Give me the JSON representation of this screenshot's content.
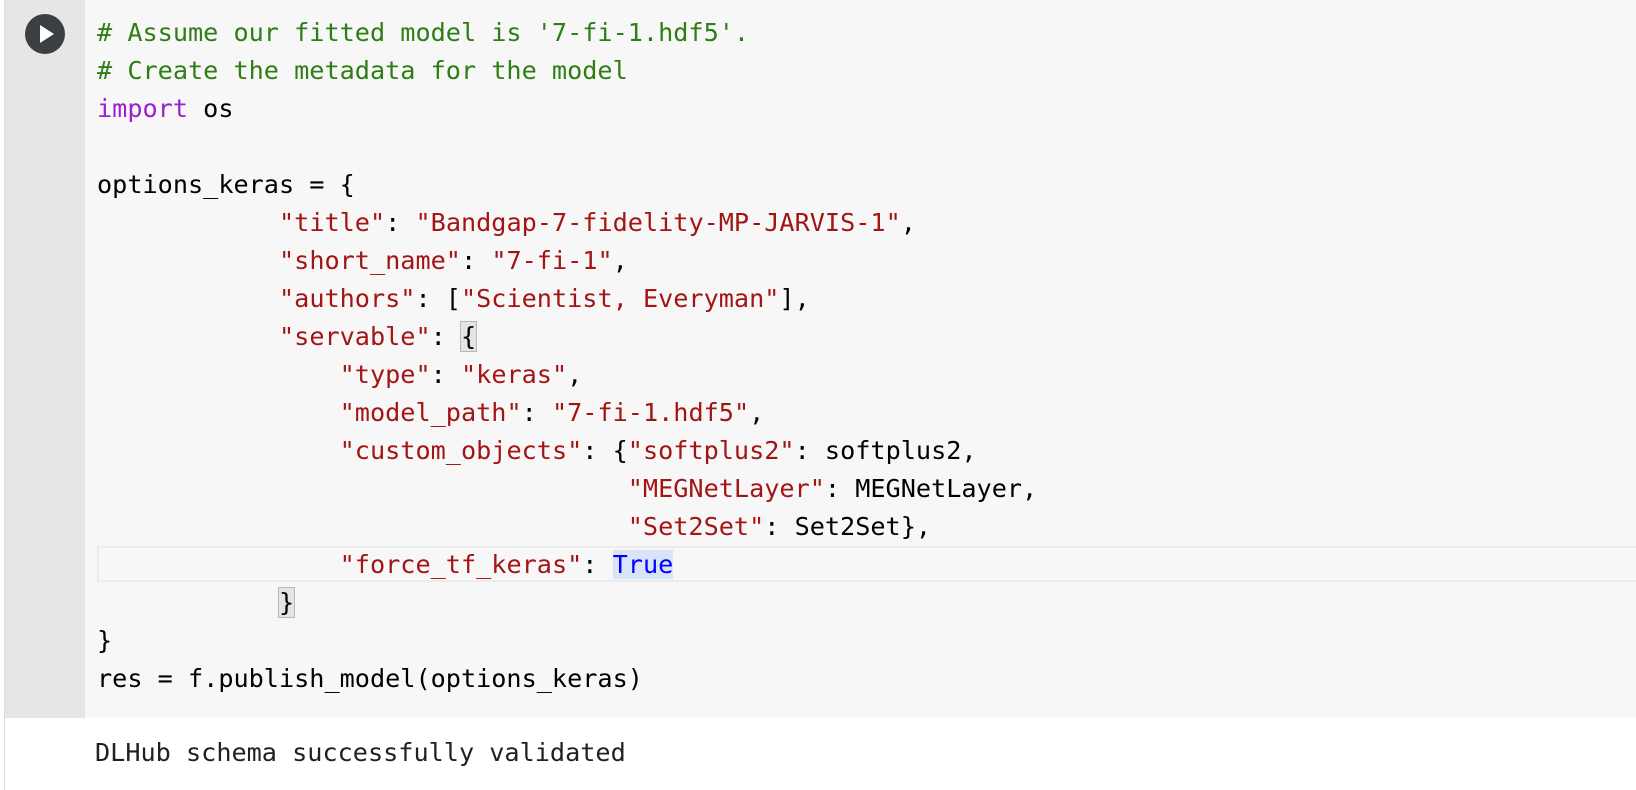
{
  "run_button": {
    "icon": "play-icon"
  },
  "code_lines": [
    [
      {
        "t": "cmt",
        "v": "# Assume our fitted model is '7-fi-1.hdf5'."
      }
    ],
    [
      {
        "t": "cmt",
        "v": "# Create the metadata for the model"
      }
    ],
    [
      {
        "t": "kw",
        "v": "import"
      },
      {
        "t": "",
        "v": " os"
      }
    ],
    [
      {
        "t": "",
        "v": ""
      }
    ],
    [
      {
        "t": "",
        "v": "options_keras = {"
      }
    ],
    [
      {
        "t": "",
        "v": "            "
      },
      {
        "t": "str",
        "v": "\"title\""
      },
      {
        "t": "",
        "v": ": "
      },
      {
        "t": "str",
        "v": "\"Bandgap-7-fidelity-MP-JARVIS-1\""
      },
      {
        "t": "",
        "v": ","
      }
    ],
    [
      {
        "t": "",
        "v": "            "
      },
      {
        "t": "str",
        "v": "\"short_name\""
      },
      {
        "t": "",
        "v": ": "
      },
      {
        "t": "str",
        "v": "\"7-fi-1\""
      },
      {
        "t": "",
        "v": ","
      }
    ],
    [
      {
        "t": "",
        "v": "            "
      },
      {
        "t": "str",
        "v": "\"authors\""
      },
      {
        "t": "",
        "v": ": ["
      },
      {
        "t": "str",
        "v": "\"Scientist, Everyman\""
      },
      {
        "t": "",
        "v": "],"
      }
    ],
    [
      {
        "t": "",
        "v": "            "
      },
      {
        "t": "str",
        "v": "\"servable\""
      },
      {
        "t": "",
        "v": ": "
      },
      {
        "t": "bracket",
        "v": "{"
      }
    ],
    [
      {
        "t": "",
        "v": "                "
      },
      {
        "t": "str",
        "v": "\"type\""
      },
      {
        "t": "",
        "v": ": "
      },
      {
        "t": "str",
        "v": "\"keras\""
      },
      {
        "t": "",
        "v": ","
      }
    ],
    [
      {
        "t": "",
        "v": "                "
      },
      {
        "t": "str",
        "v": "\"model_path\""
      },
      {
        "t": "",
        "v": ": "
      },
      {
        "t": "str",
        "v": "\"7-fi-1.hdf5\""
      },
      {
        "t": "",
        "v": ","
      }
    ],
    [
      {
        "t": "",
        "v": "                "
      },
      {
        "t": "str",
        "v": "\"custom_objects\""
      },
      {
        "t": "",
        "v": ": {"
      },
      {
        "t": "str",
        "v": "\"softplus2\""
      },
      {
        "t": "",
        "v": ": softplus2,"
      }
    ],
    [
      {
        "t": "",
        "v": "                                   "
      },
      {
        "t": "str",
        "v": "\"MEGNetLayer\""
      },
      {
        "t": "",
        "v": ": MEGNetLayer,"
      }
    ],
    [
      {
        "t": "",
        "v": "                                   "
      },
      {
        "t": "str",
        "v": "\"Set2Set\""
      },
      {
        "t": "",
        "v": ": Set2Set},"
      }
    ],
    [
      {
        "t": "",
        "v": "                "
      },
      {
        "t": "str",
        "v": "\"force_tf_keras\""
      },
      {
        "t": "",
        "v": ": "
      },
      {
        "t": "const",
        "v": "True"
      }
    ],
    [
      {
        "t": "",
        "v": "            "
      },
      {
        "t": "bracket",
        "v": "}"
      }
    ],
    [
      {
        "t": "",
        "v": "}"
      }
    ],
    [
      {
        "t": "",
        "v": "res = f.publish_model(options_keras)"
      }
    ]
  ],
  "output": {
    "text": "DLHub schema successfully validated"
  }
}
